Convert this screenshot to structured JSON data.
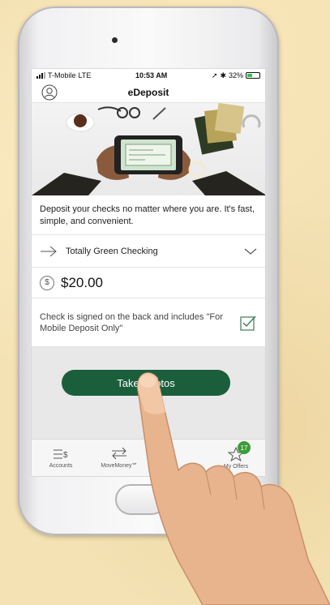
{
  "status": {
    "carrier": "T-Mobile",
    "network": "LTE",
    "time": "10:53 AM",
    "battery": "32%"
  },
  "nav": {
    "title": "eDeposit",
    "profile_icon": "person-icon"
  },
  "description": "Deposit your checks no matter where you are. It's fast, simple, and convenient.",
  "account": {
    "label": "Totally Green Checking",
    "arrow_icon": "arrow-right-icon",
    "chevron_icon": "chevron-down-icon"
  },
  "amount": {
    "symbol": "$",
    "value": "$20.00"
  },
  "check": {
    "label": "Check is signed on the back and includes \"For Mobile Deposit Only\"",
    "checked": true
  },
  "take_button": {
    "label": "Take Photos"
  },
  "tabs": [
    {
      "label": "Accounts",
      "icon": "accounts-icon"
    },
    {
      "label": "MoveMoney℠",
      "icon": "transfer-arrows-icon"
    },
    {
      "label": "",
      "icon": ""
    },
    {
      "label": "My Offers",
      "icon": "star-icon",
      "badge": "17"
    }
  ],
  "colors": {
    "brand_green": "#1b5e3b",
    "badge_green": "#3c9c3a",
    "background": "#f4e2b4"
  }
}
